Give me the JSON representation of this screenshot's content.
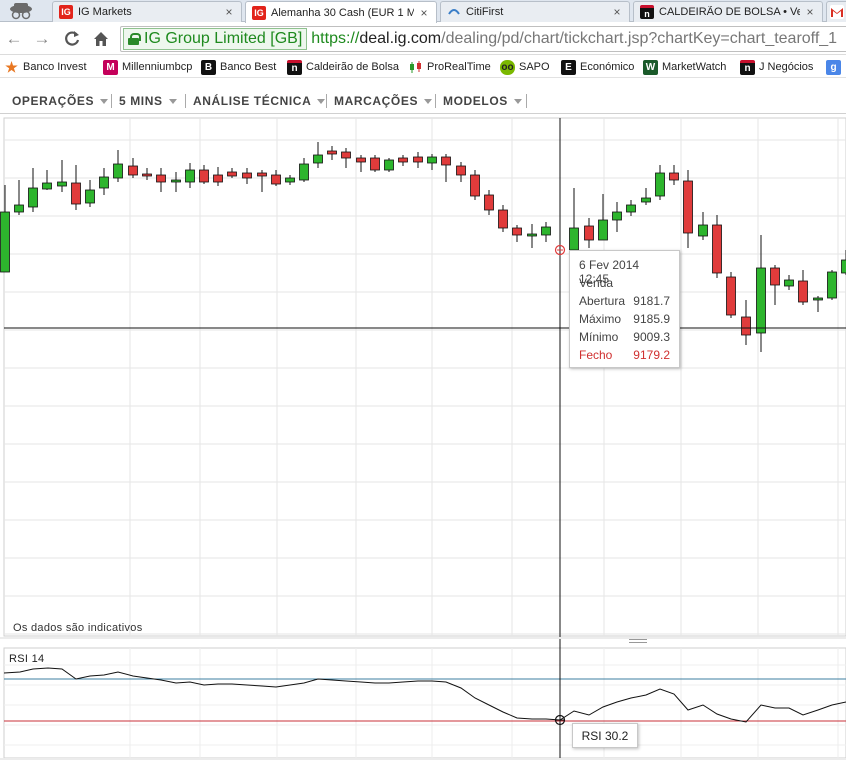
{
  "browser": {
    "tabs": [
      {
        "label": "IG Markets",
        "favicon": "IG",
        "color": "#e2231a",
        "active": false
      },
      {
        "label": "Alemanha 30 Cash (EUR 1 M",
        "favicon": "IG",
        "color": "#e2231a",
        "active": true
      },
      {
        "label": "CitiFirst",
        "favicon": "citi",
        "color": "#3a7ec8",
        "active": false
      },
      {
        "label": "CALDEIRÃO DE BOLSA • Ver",
        "favicon": "n",
        "color": "#c8102e",
        "active": false
      }
    ],
    "close_glyph": "×",
    "cert_label": "IG Group Limited [GB]",
    "url_scheme": "https://",
    "url_host": "deal.ig.com",
    "url_path": "/dealing/pd/chart/tickchart.jsp?chartKey=chart_tearoff_1",
    "bookmarks": [
      {
        "label": "Banco Invest",
        "icon": "star-icon",
        "icon_glyph": "★",
        "color": "#e87722"
      },
      {
        "label": "Millenniumbcp",
        "icon": "M",
        "icon_glyph": "M",
        "color": "#c4005a"
      },
      {
        "label": "Banco Best",
        "icon": "B",
        "icon_glyph": "B",
        "color": "#111111"
      },
      {
        "label": "Caldeirão de Bolsa",
        "icon": "n",
        "icon_glyph": "n",
        "color": "#c8102e"
      },
      {
        "label": "ProRealTime",
        "icon": "candles-icon",
        "icon_glyph": "",
        "color": "#2a9a2a"
      },
      {
        "label": "SAPO",
        "icon": "sapo-icon",
        "icon_glyph": "oo",
        "color": "#7ab800"
      },
      {
        "label": "Económico",
        "icon": "E",
        "icon_glyph": "E",
        "color": "#111111"
      },
      {
        "label": "MarketWatch",
        "icon": "W",
        "icon_glyph": "W",
        "color": "#1a5a2a"
      },
      {
        "label": "J  Negócios",
        "icon": "n",
        "icon_glyph": "n",
        "color": "#c8102e"
      },
      {
        "label": "",
        "icon": "google-icon",
        "icon_glyph": "g",
        "color": "#4a86e8"
      }
    ]
  },
  "app_menu": {
    "items": [
      {
        "label": "OPERAÇÕES"
      },
      {
        "label": "5 MINS"
      },
      {
        "label": "ANÁLISE TÉCNICA"
      },
      {
        "label": "MARCAÇÕES"
      },
      {
        "label": "MODELOS"
      }
    ]
  },
  "chart": {
    "note": "Os dados são indicativos",
    "colors": {
      "up": "#2db52d",
      "down": "#e03b3b",
      "wick": "#111111",
      "crosshair": "#111111",
      "rsi_line": "#111111",
      "rsi_upper": "#3c7fa0",
      "rsi_lower": "#c8303a"
    },
    "tooltip": {
      "date": "6 Fev 2014 12:45",
      "side": "Venda",
      "rows": [
        {
          "label": "Abertura",
          "value": "9181.7"
        },
        {
          "label": "Máximo",
          "value": "9185.9"
        },
        {
          "label": "Mínimo",
          "value": "9009.3"
        },
        {
          "label": "Fecho",
          "value": "9179.2"
        }
      ]
    },
    "rsi": {
      "label": "RSI  14",
      "tooltip": "RSI  30.2"
    }
  },
  "chart_data": {
    "type": "candlestick",
    "interval": "5 MINS",
    "indicator": "RSI 14",
    "selected_candle": {
      "time": "6 Fev 2014 12:45",
      "open": 9181.7,
      "high": 9185.9,
      "low": 9009.3,
      "close": 9179.2
    },
    "rsi_selected": 30.2
  }
}
